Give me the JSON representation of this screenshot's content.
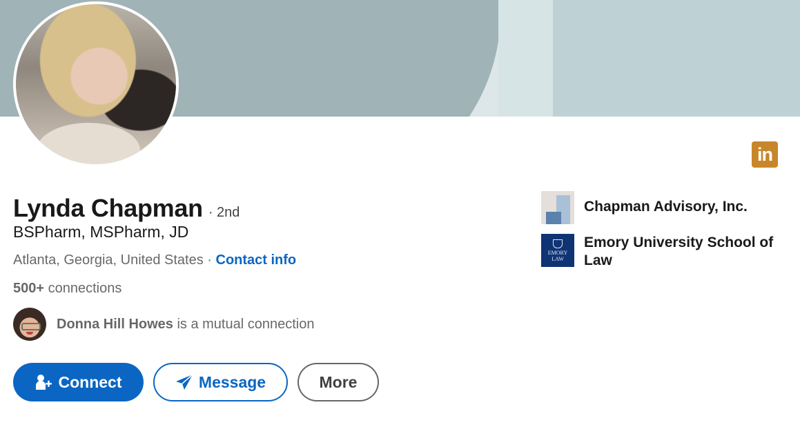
{
  "profile": {
    "name": "Lynda Chapman",
    "degree": "· 2nd",
    "headline": "BSPharm, MSPharm, JD",
    "location": "Atlanta, Georgia, United States",
    "separator": " · ",
    "contact_info": "Contact info",
    "connections_count": "500+",
    "connections_label": " connections"
  },
  "mutual": {
    "name": "Donna Hill Howes",
    "text": " is a mutual connection"
  },
  "actions": {
    "connect": "Connect",
    "message": "Message",
    "more": "More"
  },
  "badge": {
    "label": "in"
  },
  "organizations": [
    {
      "name": "Chapman Advisory, Inc."
    },
    {
      "name": "Emory University School of Law",
      "logo_text_top": "EMORY",
      "logo_text_bottom": "LAW"
    }
  ],
  "colors": {
    "accent": "#0a66c2",
    "badge": "#c8862a",
    "banner_dark": "#a0b3b6",
    "banner_light": "#bed2d6"
  },
  "icons": {
    "connect": "person-add-icon",
    "message": "paper-plane-icon",
    "badge": "linkedin-icon"
  }
}
